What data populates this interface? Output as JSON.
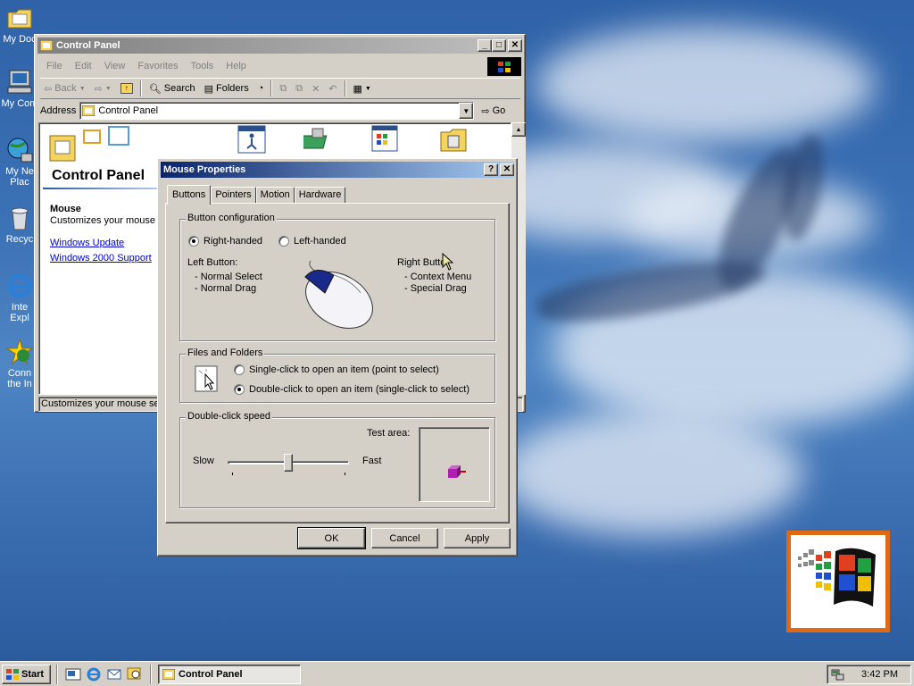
{
  "desktop": {
    "icons": [
      {
        "label": "My Doc"
      },
      {
        "label": "My Com"
      },
      {
        "label": "My Ne",
        "label2": "Plac"
      },
      {
        "label": "Recyc"
      },
      {
        "label": "Inte",
        "label2": "Expl"
      },
      {
        "label": "Conn",
        "label2": "the In"
      }
    ]
  },
  "control_panel": {
    "title": "Control Panel",
    "menu": [
      "File",
      "Edit",
      "View",
      "Favorites",
      "Tools",
      "Help"
    ],
    "toolbar": {
      "back": "Back",
      "search": "Search",
      "folders": "Folders"
    },
    "address_label": "Address",
    "address_value": "Control Panel",
    "go_label": "Go",
    "side_title": "Control Panel",
    "selected_title": "Mouse",
    "selected_desc": "Customizes your mouse s",
    "links": [
      "Windows Update",
      "Windows 2000 Support"
    ],
    "status": "Customizes your mouse sett"
  },
  "dialog": {
    "title": "Mouse Properties",
    "tabs": [
      "Buttons",
      "Pointers",
      "Motion",
      "Hardware"
    ],
    "active_tab": "Buttons",
    "button_config": {
      "title": "Button configuration",
      "right_handed": "Right-handed",
      "left_handed": "Left-handed",
      "selected": "Right-handed",
      "left_button_label": "Left Button:",
      "left_items": [
        "-  Normal Select",
        "-  Normal Drag"
      ],
      "right_button_label": "Right Butto",
      "right_items": [
        "-  Context Menu",
        "-  Special Drag"
      ]
    },
    "files_folders": {
      "title": "Files and Folders",
      "single": "Single-click to open an item (point to select)",
      "double": "Double-click to open an item (single-click to select)",
      "selected": "double"
    },
    "double_click": {
      "title": "Double-click speed",
      "test_area": "Test area:",
      "slow": "Slow",
      "fast": "Fast",
      "slider_value": 0.5
    },
    "buttons": {
      "ok": "OK",
      "cancel": "Cancel",
      "apply": "Apply"
    }
  },
  "taskbar": {
    "start": "Start",
    "task": "Control Panel",
    "clock": "3:42 PM"
  },
  "colors": {
    "active_title": "#0a246a",
    "inactive_title": "#808080",
    "face": "#d4d0c8",
    "link": "#0000cc"
  }
}
